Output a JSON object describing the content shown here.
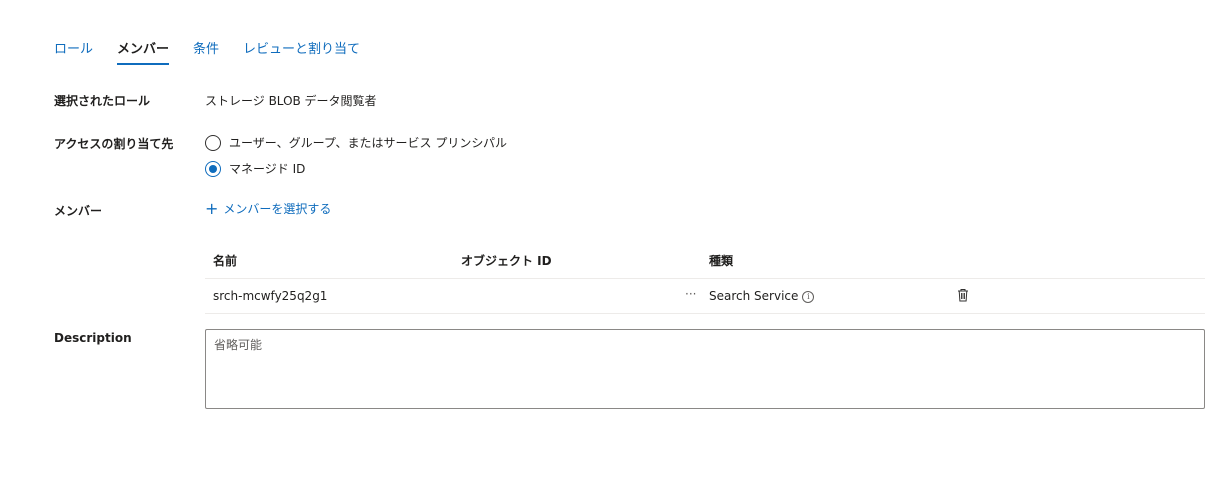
{
  "tabs": [
    {
      "label": "ロール",
      "active": false
    },
    {
      "label": "メンバー",
      "active": true
    },
    {
      "label": "条件",
      "active": false
    },
    {
      "label": "レビューと割り当て",
      "active": false
    }
  ],
  "selected_role": {
    "label": "選択されたロール",
    "value": "ストレージ BLOB データ閲覧者"
  },
  "assign_access": {
    "label": "アクセスの割り当て先",
    "options": [
      {
        "label": "ユーザー、グループ、またはサービス プリンシパル",
        "checked": false
      },
      {
        "label": "マネージド ID",
        "checked": true
      }
    ]
  },
  "members": {
    "label": "メンバー",
    "add_label": "メンバーを選択する",
    "columns": {
      "name": "名前",
      "object_id": "オブジェクト ID",
      "type": "種類"
    },
    "rows": [
      {
        "name": "srch-mcwfy25q2g1",
        "object_id": "···",
        "type": "Search Service"
      }
    ]
  },
  "description": {
    "label": "Description",
    "placeholder": "省略可能"
  },
  "colors": {
    "accent": "#0f6cbd",
    "text": "#201f1e",
    "border": "#8a8886"
  }
}
